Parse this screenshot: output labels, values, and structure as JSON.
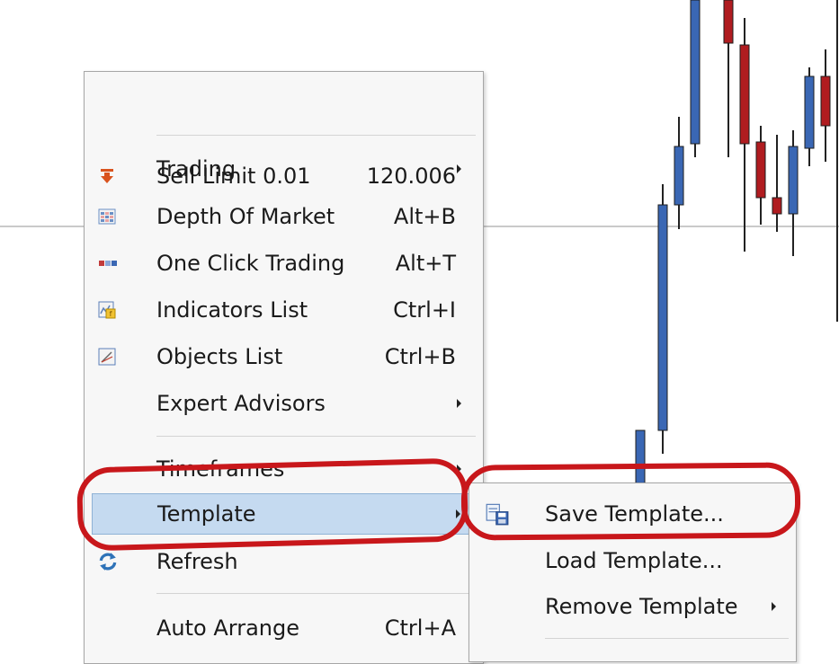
{
  "chart": {
    "colors": {
      "bull": "#3a67b4",
      "bear": "#b01c20",
      "wick": "#222222",
      "grid": "#b9b9b9"
    }
  },
  "context_menu": {
    "items": [
      {
        "icon": "sell-arrow-icon",
        "label": "Sell Limit 0.01",
        "shortcut": "120.006"
      },
      {
        "label": "Trading",
        "has_submenu": true
      },
      {
        "icon": "depth-of-market-icon",
        "label": "Depth Of Market",
        "shortcut": "Alt+B"
      },
      {
        "icon": "one-click-trading-icon",
        "label": "One Click Trading",
        "shortcut": "Alt+T"
      },
      {
        "icon": "indicators-list-icon",
        "label": "Indicators List",
        "shortcut": "Ctrl+I"
      },
      {
        "icon": "objects-list-icon",
        "label": "Objects List",
        "shortcut": "Ctrl+B"
      },
      {
        "label": "Expert Advisors",
        "has_submenu": true
      },
      {
        "label": "Timeframes",
        "has_submenu": true
      },
      {
        "label": "Template",
        "has_submenu": true,
        "highlighted": true
      },
      {
        "icon": "refresh-icon",
        "label": "Refresh"
      },
      {
        "label": "Auto Arrange",
        "shortcut": "Ctrl+A"
      }
    ]
  },
  "template_submenu": {
    "items": [
      {
        "icon": "save-template-icon",
        "label": "Save Template..."
      },
      {
        "label": "Load Template..."
      },
      {
        "label": "Remove Template",
        "has_submenu": true
      }
    ]
  },
  "annotation_color": "#c8171b"
}
